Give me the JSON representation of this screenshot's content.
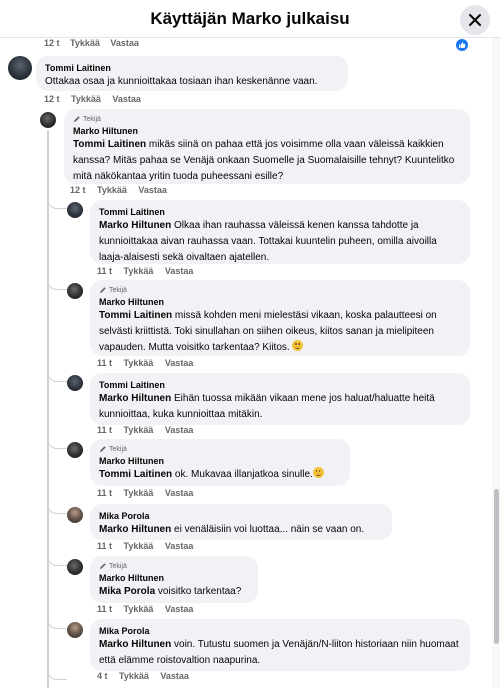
{
  "header": {
    "title": "Käyttäjän Marko julkaisu"
  },
  "top_actions": {
    "time": "12 t",
    "like": "Tykkää",
    "reply": "Vastaa"
  },
  "author_badge_label": "Tekijä",
  "comments": [
    {
      "author": "Tommi Laitinen",
      "mention": "",
      "text": "Ottakaa osaa ja kunnioittakaa tosiaan ihan keskenänne vaan.",
      "time": "12 t",
      "like": "Tykkää",
      "reply": "Vastaa"
    },
    {
      "author": "Marko Hiltunen",
      "mention": "Tommi Laitinen",
      "text": " mikäs siinä on pahaa että jos voisimme olla vaan väleissä kaikkien kanssa? Mitäs pahaa se Venäjä onkaan Suomelle ja Suomalaisille tehnyt? Kuuntelitko mitä näkökantaa yritin tuoda puheessani esille?",
      "time": "12 t",
      "like": "Tykkää",
      "reply": "Vastaa"
    },
    {
      "author": "Tommi Laitinen",
      "mention": "Marko Hiltunen",
      "text": " Olkaa ihan rauhassa väleissä kenen kanssa tahdotte ja kunnioittakaa aivan rauhassa vaan. Tottakai kuuntelin puheen, omilla aivoilla laaja-alaisesti sekä oivaltaen ajatellen.",
      "time": "11 t",
      "like": "Tykkää",
      "reply": "Vastaa"
    },
    {
      "author": "Marko Hiltunen",
      "mention": "Tommi Laitinen",
      "text": " missä kohden meni mielestäsi vikaan, koska palautteesi on selvästi kriittistä. Toki sinullahan on siihen oikeus, kiitos sanan ja mielipiteen vapauden. Mutta voisitko tarkentaa? Kiitos.",
      "time": "11 t",
      "like": "Tykkää",
      "reply": "Vastaa"
    },
    {
      "author": "Tommi Laitinen",
      "mention": "Marko Hiltunen",
      "text": " Eihän tuossa mikään vikaan mene jos haluat/haluatte heitä kunnioittaa, kuka kunnioittaa mitäkin.",
      "time": "11 t",
      "like": "Tykkää",
      "reply": "Vastaa"
    },
    {
      "author": "Marko Hiltunen",
      "mention": "Tommi Laitinen",
      "text": " ok. Mukavaa illanjatkoa sinulle.",
      "time": "11 t",
      "like": "Tykkää",
      "reply": "Vastaa"
    },
    {
      "author": "Mika Porola",
      "mention": "Marko Hiltunen",
      "text": " ei venäläisiin voi luottaa... näin se vaan on.",
      "time": "11 t",
      "like": "Tykkää",
      "reply": "Vastaa"
    },
    {
      "author": "Marko Hiltunen",
      "mention": "Mika Porola",
      "text": " voisitko tarkentaa?",
      "time": "11 t",
      "like": "Tykkää",
      "reply": "Vastaa"
    },
    {
      "author": "Mika Porola",
      "mention": "Marko Hiltunen",
      "text": " voin. Tutustu suomen ja Venäjän/N-liiton historiaan niin huomaat että elämme roistovaltion naapurina.",
      "time": "4 t",
      "like": "Tykkää",
      "reply": "Vastaa"
    }
  ],
  "colors": {
    "accent": "#1877f2",
    "bubble": "#f0f2f5",
    "meta": "#65676b"
  }
}
